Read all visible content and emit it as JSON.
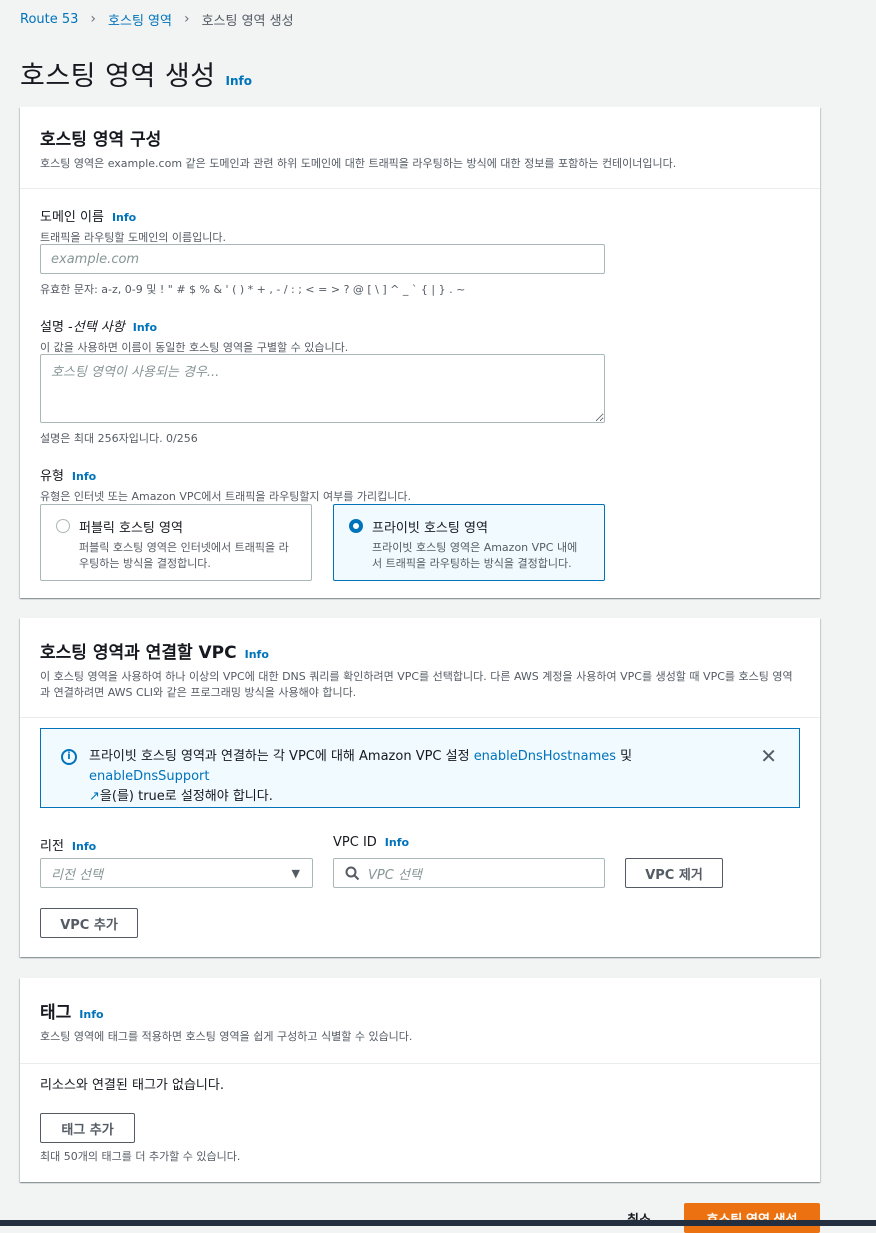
{
  "breadcrumb": {
    "items": [
      "Route 53",
      "호스팅 영역",
      "호스팅 영역 생성"
    ]
  },
  "page": {
    "title": "호스팅 영역 생성",
    "info": "Info"
  },
  "config": {
    "title": "호스팅 영역 구성",
    "desc": "호스팅 영역은 example.com 같은 도메인과 관련 하위 도메인에 대한 트래픽을 라우팅하는 방식에 대한 정보를 포함하는 컨테이너입니다.",
    "domain": {
      "label": "도메인 이름",
      "info": "Info",
      "desc": "트래픽을 라우팅할 도메인의 이름입니다.",
      "placeholder": "example.com",
      "value": "",
      "constraint": "유효한 문자: a-z, 0-9 및 ! \" # $ % & ' ( ) * + , - / : ; < = > ? @ [ \\ ] ^ _ ` { | } . ~"
    },
    "description": {
      "label_main": "설명 - ",
      "label_optional": "선택 사항",
      "info": "Info",
      "desc": "이 값을 사용하면 이름이 동일한 호스팅 영역을 구별할 수 있습니다.",
      "placeholder": "호스팅 영역이 사용되는 경우...",
      "constraint": "설명은 최대 256자입니다. 0/256"
    },
    "type": {
      "label": "유형",
      "info": "Info",
      "desc": "유형은 인터넷 또는 Amazon VPC에서 트래픽을 라우팅할지 여부를 가리킵니다.",
      "options": [
        {
          "title": "퍼블릭 호스팅 영역",
          "desc1": "퍼블릭 호스팅 영역은 인터넷에서 트래픽을 라",
          "desc2": "우팅하는 방식을 결정합니다.",
          "selected": false
        },
        {
          "title": "프라이빗 호스팅 영역",
          "desc1": "프라이빗 호스팅 영역은 Amazon VPC 내에",
          "desc2": "서 트래픽을 라우팅하는 방식을 결정합니다.",
          "selected": true
        }
      ]
    }
  },
  "vpc": {
    "title": "호스팅 영역과 연결할 VPC",
    "info": "Info",
    "desc_line1": "이 호스팅 영역을 사용하여 하나 이상의 VPC에 대한 DNS 쿼리를 확인하려면 VPC를 선택합니다. 다른 AWS 계정을 사용하여 VPC를 생성할 때 VPC를 호스팅 영역",
    "desc_line2": "과 연결하려면 AWS CLI와 같은 프로그래밍 방식을 사용해야 합니다.",
    "alert": {
      "text_before": "프라이빗 호스팅 영역과 연결하는 각 VPC에 대해 Amazon VPC 설정 ",
      "link1": "enableDnsHostnames",
      "text_mid": " 및 ",
      "link2": "enableDnsSupport",
      "text_after": "을(를) true로 설정해야 합니다."
    },
    "region": {
      "label": "리전",
      "info": "Info",
      "placeholder": "리전 선택"
    },
    "vpc_id": {
      "label": "VPC ID",
      "info": "Info",
      "placeholder": "VPC 선택"
    },
    "remove_button": "VPC 제거",
    "add_button": "VPC 추가"
  },
  "tags": {
    "title": "태그",
    "info": "Info",
    "desc": "호스팅 영역에 태그를 적용하면 호스팅 영역을 쉽게 구성하고 식별할 수 있습니다.",
    "empty": "리소스와 연결된 태그가 없습니다.",
    "add_button": "태그 추가",
    "limit": "최대 50개의 태그를 더 추가할 수 있습니다."
  },
  "footer": {
    "cancel": "취소",
    "create": "호스팅 영역 생성"
  },
  "colors": {
    "link": "#0073bb",
    "primary_button": "#ec7211",
    "selected_tile_bg": "#f1faff"
  }
}
